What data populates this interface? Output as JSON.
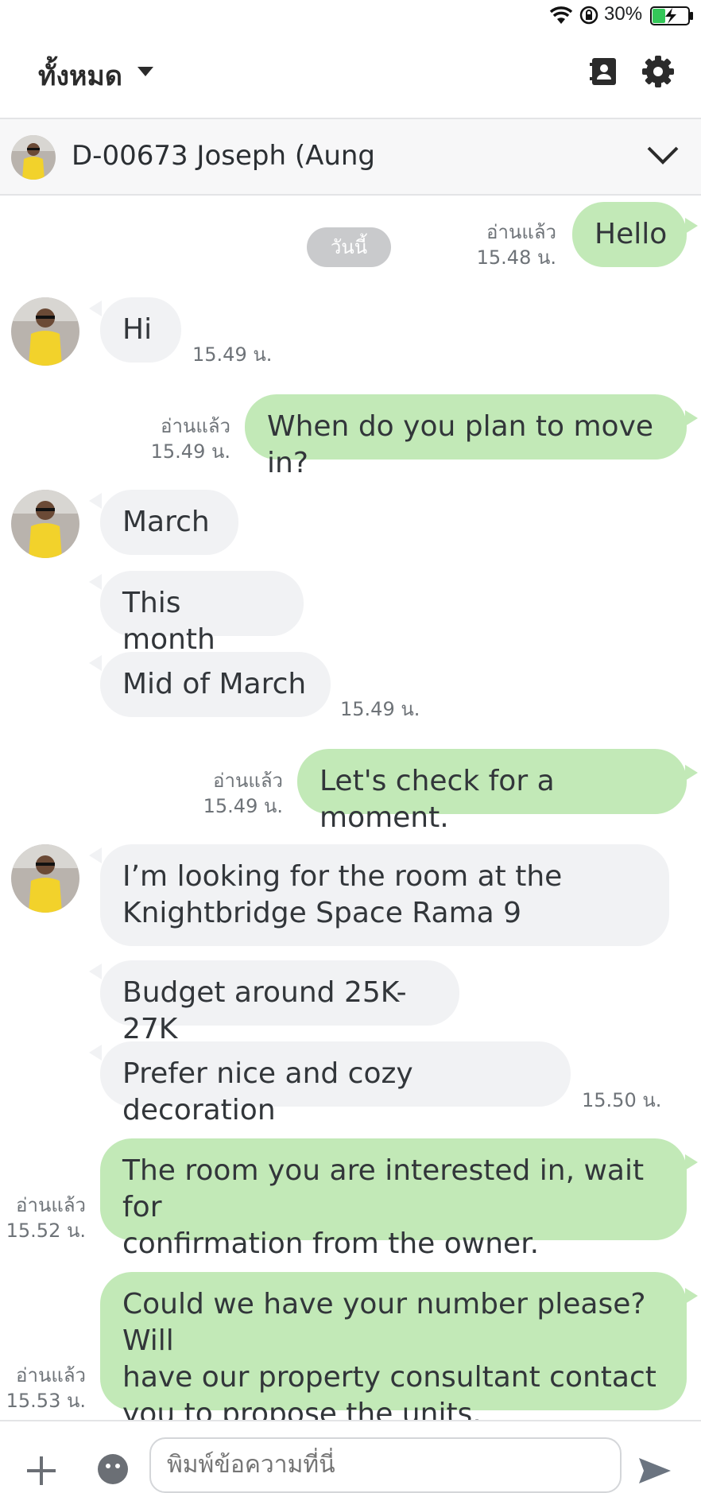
{
  "status_bar": {
    "battery_percent": "30%",
    "battery_level": 0.3,
    "icons": [
      "wifi-icon",
      "rotation-lock-icon",
      "battery-charging-icon"
    ]
  },
  "header": {
    "title": "ทั้งหมด",
    "icons": [
      "caret-down-icon",
      "contact-card-icon",
      "gear-icon"
    ]
  },
  "chat_header": {
    "contact_name": "D-00673 Joseph (Aung"
  },
  "date_chip": "วันนี้",
  "messages": [
    {
      "dir": "out",
      "text": "Hello",
      "read": "อ่านแล้ว",
      "time": "15.48 น."
    },
    {
      "dir": "in",
      "text": "Hi",
      "time": "15.49 น."
    },
    {
      "dir": "out",
      "text": "When do you plan to move in?",
      "read": "อ่านแล้ว",
      "time": "15.49 น."
    },
    {
      "dir": "in",
      "text": "March"
    },
    {
      "dir": "in",
      "text": "This month"
    },
    {
      "dir": "in",
      "text": "Mid of March",
      "time": "15.49 น."
    },
    {
      "dir": "out",
      "text": "Let's check for a moment.",
      "read": "อ่านแล้ว",
      "time": "15.49 น."
    },
    {
      "dir": "in",
      "line1": "I’m looking for the room at the",
      "line2": "Knightbridge Space Rama 9"
    },
    {
      "dir": "in",
      "text": "Budget around 25K-27K"
    },
    {
      "dir": "in",
      "text": "Prefer nice and cozy decoration",
      "time": "15.50 น."
    },
    {
      "dir": "out",
      "line1": "The room you are interested in, wait for",
      "line2": "confirmation from the owner.",
      "read": "อ่านแล้ว",
      "time": "15.52 น."
    },
    {
      "dir": "out",
      "line1": "Could we have your number please? Will",
      "line2": "have our property consultant contact",
      "line3": "you to propose the units.",
      "read": "อ่านแล้ว",
      "time": "15.53 น."
    }
  ],
  "input": {
    "placeholder": "พิมพ์ข้อความที่นี่"
  },
  "colors": {
    "outgoing_bubble": "#c2e9b7",
    "incoming_bubble": "#f1f2f4",
    "date_chip": "#c9cacc",
    "meta_text": "#6e7378"
  }
}
